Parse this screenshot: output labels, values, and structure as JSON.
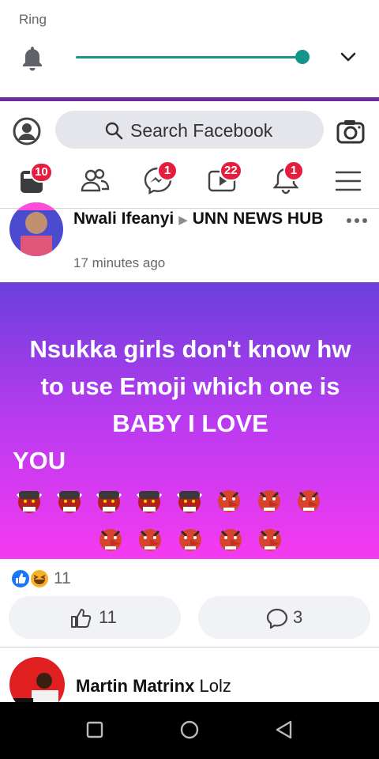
{
  "notification_shade": {
    "label": "Ring",
    "volume": 1.0
  },
  "search": {
    "placeholder": "Search Facebook"
  },
  "tabs": [
    {
      "name": "news-feed",
      "badge": "10"
    },
    {
      "name": "friends",
      "badge": ""
    },
    {
      "name": "messenger",
      "badge": "1"
    },
    {
      "name": "watch",
      "badge": "22"
    },
    {
      "name": "notifications",
      "badge": "1"
    },
    {
      "name": "menu",
      "badge": ""
    }
  ],
  "post": {
    "author": "Nwali Ifeanyi",
    "group": "UNN NEWS HUB",
    "time": "17 minutes ago",
    "text_lines": [
      "Nsukka girls don't know hw",
      "to use Emoji which one is",
      "BABY I LOVE",
      "YOU"
    ],
    "reactions_count": "11",
    "like_count": "11",
    "comment_count": "3"
  },
  "comment": {
    "author": "Martin Matrinx",
    "text": "Lolz"
  },
  "colors": {
    "facebook_blue": "#1877f2",
    "badge_red": "#e41e3f",
    "slider_teal": "#14968a",
    "gradient_top": "#6a3fdc",
    "gradient_bottom": "#f53af0"
  }
}
